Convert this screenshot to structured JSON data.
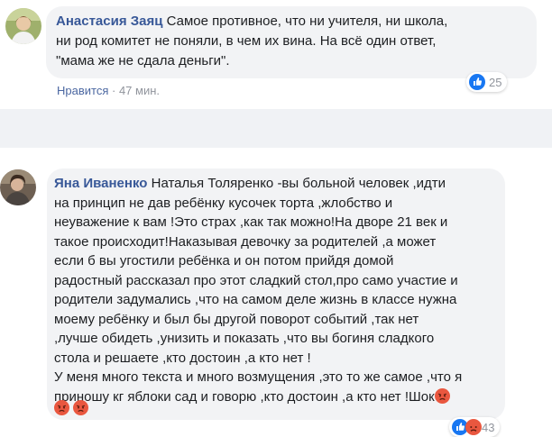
{
  "comments": [
    {
      "author": "Анастасия Заяц",
      "text": " Самое противное, что ни учителя, ни школа,\nни род комитет не поняли, в чем их вина. На всё один ответ,\n\"мама же не сдала деньги\".",
      "like_label": "Нравится",
      "separator": " · ",
      "time": "47 мин.",
      "reaction_count": "25"
    },
    {
      "author": "Яна Иваненко",
      "text": " Наталья Толяренко -вы больной человек ,идти\nна принцип не дав ребёнку кусочек торта ,жлобство и\nнеуважение к вам !Это страх ,как так можно!На дворе 21 век и\nтакое происходит!Наказывая девочку за родителей ,а может\nесли б вы угостили ребёнка и он потом прийдя домой\nрадостный рассказал про этот сладкий стол,про само участие и\nродители задумались ,что на самом деле жизнь в классе нужна\nмоему ребёнку и был бы другой поворот событий ,так нет\n,лучше обидеть ,унизить и показать ,что вы богиня сладкого\nстола и решаете ,кто достоин ,а кто нет !\nУ меня много текста и много возмущения ,это то же самое ,что я\nприношу кг яблоки сад и говорю ,кто достоин ,а кто нет !Шок",
      "reaction_count": "43"
    }
  ],
  "icons": {
    "like": "like-icon",
    "angry": "angry-face-icon"
  },
  "colors": {
    "author": "#385898",
    "bubble": "#f2f3f5",
    "like_blue": "#1877f2",
    "angry": "#e9573f"
  }
}
